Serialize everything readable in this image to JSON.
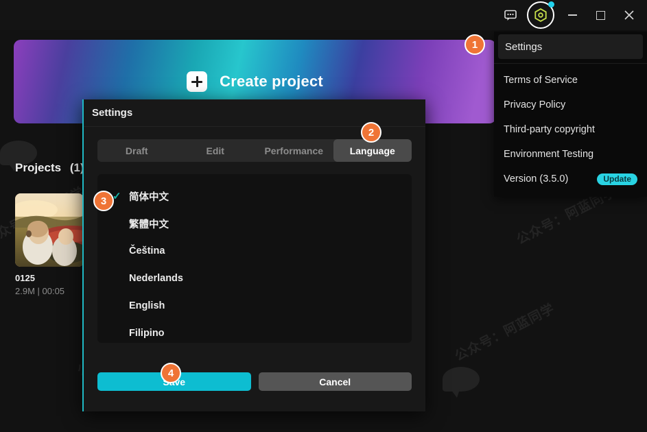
{
  "titlebar": {
    "feedback_icon": "speech-bubble-icon",
    "settings_icon": "hex-gear-icon",
    "minimize_label": "–",
    "maximize_label": "□",
    "close_label": "✕"
  },
  "banner": {
    "plus_icon": "plus-icon",
    "label": "Create project"
  },
  "projects": {
    "heading": "Projects",
    "count": "(1)",
    "items": [
      {
        "name": "0125",
        "meta": "2.9M | 00:05"
      }
    ]
  },
  "menu": {
    "header": "Settings",
    "items": [
      {
        "label": "Terms of Service",
        "badge": ""
      },
      {
        "label": "Privacy Policy",
        "badge": ""
      },
      {
        "label": "Third-party copyright",
        "badge": ""
      },
      {
        "label": "Environment Testing",
        "badge": ""
      },
      {
        "label": "Version (3.5.0)",
        "badge": "Update"
      }
    ]
  },
  "dialog": {
    "title": "Settings",
    "tabs": [
      {
        "label": "Draft",
        "active": false
      },
      {
        "label": "Edit",
        "active": false
      },
      {
        "label": "Performance",
        "active": false
      },
      {
        "label": "Language",
        "active": true
      }
    ],
    "languages": [
      {
        "label": "简体中文",
        "selected": true
      },
      {
        "label": "繁體中文",
        "selected": false
      },
      {
        "label": "Čeština",
        "selected": false
      },
      {
        "label": "Nederlands",
        "selected": false
      },
      {
        "label": "English",
        "selected": false
      },
      {
        "label": "Filipino",
        "selected": false
      }
    ],
    "check_glyph": "✓",
    "save_label": "Save",
    "cancel_label": "Cancel"
  },
  "steps": [
    {
      "n": "1"
    },
    {
      "n": "2"
    },
    {
      "n": "3"
    },
    {
      "n": "4"
    }
  ],
  "watermark": {
    "text": "公众号：阿蓝同学"
  },
  "colors": {
    "accent_cyan": "#0dbdd1",
    "step_orange": "#ef7436",
    "update_badge": "#29d3e3",
    "check_teal": "#19b4a8",
    "tab_active": "#4a4a4a"
  }
}
